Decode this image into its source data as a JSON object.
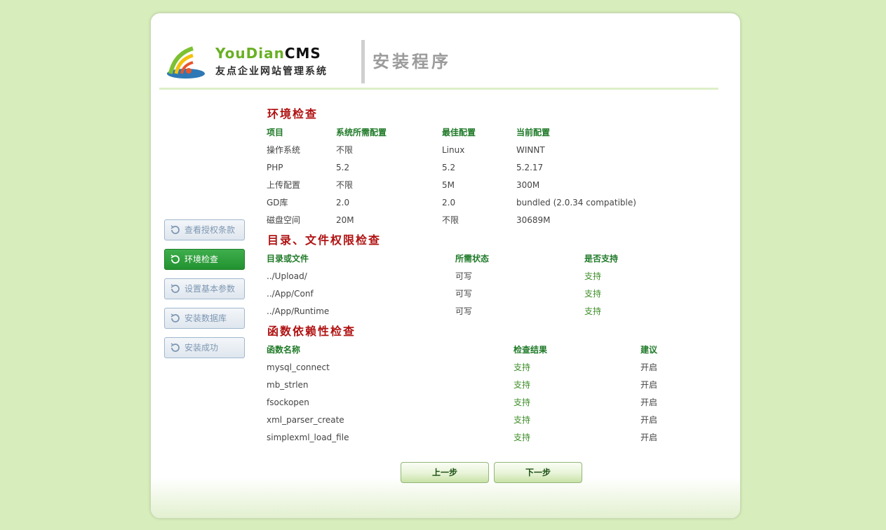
{
  "logo": {
    "en_part1": "YouDian",
    "en_part2": "CMS",
    "cn": "友点企业网站管理系统"
  },
  "header": {
    "title": "安装程序"
  },
  "steps": [
    {
      "label": "查看授权条款",
      "active": false
    },
    {
      "label": "环境检查",
      "active": true
    },
    {
      "label": "设置基本参数",
      "active": false
    },
    {
      "label": "安装数据库",
      "active": false
    },
    {
      "label": "安装成功",
      "active": false
    }
  ],
  "env": {
    "title": "环境检查",
    "headers": [
      "项目",
      "系统所需配置",
      "最佳配置",
      "当前配置"
    ],
    "rows": [
      [
        "操作系统",
        "不限",
        "Linux",
        "WINNT"
      ],
      [
        "PHP",
        "5.2",
        "5.2",
        "5.2.17"
      ],
      [
        "上传配置",
        "不限",
        "5M",
        "300M"
      ],
      [
        "GD库",
        "2.0",
        "2.0",
        "bundled (2.0.34 compatible)"
      ],
      [
        "磁盘空间",
        "20M",
        "不限",
        "30689M"
      ]
    ]
  },
  "perm": {
    "title": "目录、文件权限检查",
    "headers": [
      "目录或文件",
      "所需状态",
      "是否支持"
    ],
    "rows": [
      [
        "../Upload/",
        "可写",
        "支持"
      ],
      [
        "../App/Conf",
        "可写",
        "支持"
      ],
      [
        "../App/Runtime",
        "可写",
        "支持"
      ]
    ]
  },
  "func": {
    "title": "函数依赖性检查",
    "headers": [
      "函数名称",
      "检查结果",
      "建议"
    ],
    "rows": [
      [
        "mysql_connect",
        "支持",
        "开启"
      ],
      [
        "mb_strlen",
        "支持",
        "开启"
      ],
      [
        "fsockopen",
        "支持",
        "开启"
      ],
      [
        "xml_parser_create",
        "支持",
        "开启"
      ],
      [
        "simplexml_load_file",
        "支持",
        "开启"
      ]
    ]
  },
  "buttons": {
    "prev": "上一步",
    "next": "下一步"
  },
  "colors": {
    "background": "#d7edbb",
    "section_title": "#b01212",
    "header_text": "#1f7a28",
    "supported": "#3f8f2a",
    "active_step": "#2ba23a"
  }
}
